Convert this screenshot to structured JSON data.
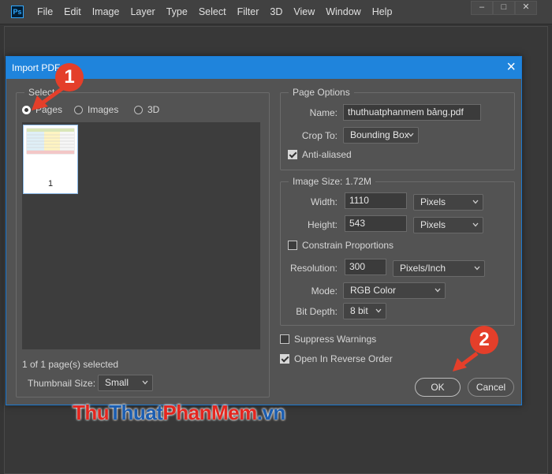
{
  "app": {
    "logo": "Ps"
  },
  "menu": [
    "File",
    "Edit",
    "Image",
    "Layer",
    "Type",
    "Select",
    "Filter",
    "3D",
    "View",
    "Window",
    "Help"
  ],
  "dialog": {
    "title": "Import PDF",
    "select": {
      "legend": "Select",
      "options": [
        "Pages",
        "Images",
        "3D"
      ],
      "selected": "Pages",
      "thumbnail_label": "1",
      "status": "1 of 1 page(s) selected",
      "thumbnail_size_label": "Thumbnail Size:",
      "thumbnail_size_value": "Small"
    },
    "page_options": {
      "legend": "Page Options",
      "name_label": "Name:",
      "name_value": "thuthuatphanmem bảng.pdf",
      "crop_label": "Crop To:",
      "crop_value": "Bounding Box",
      "anti_aliased_label": "Anti-aliased",
      "anti_aliased": true
    },
    "image_size": {
      "legend": "Image Size: 1.72M",
      "width_label": "Width:",
      "width_value": "1110",
      "width_unit": "Pixels",
      "height_label": "Height:",
      "height_value": "543",
      "height_unit": "Pixels",
      "constrain_label": "Constrain Proportions",
      "constrain": false,
      "resolution_label": "Resolution:",
      "resolution_value": "300",
      "resolution_unit": "Pixels/Inch",
      "mode_label": "Mode:",
      "mode_value": "RGB Color",
      "bit_depth_label": "Bit Depth:",
      "bit_depth_value": "8 bit"
    },
    "suppress_warnings_label": "Suppress Warnings",
    "suppress_warnings": false,
    "reverse_order_label": "Open In Reverse Order",
    "reverse_order": true,
    "ok_label": "OK",
    "cancel_label": "Cancel"
  },
  "annotations": {
    "step1": "1",
    "step2": "2"
  },
  "watermark": {
    "part1": "Thu",
    "part2": "Thuat",
    "part3": "PhanMem",
    "part4": ".vn"
  },
  "colors": {
    "accent": "#1f84dc",
    "annotation": "#e43f2a"
  }
}
